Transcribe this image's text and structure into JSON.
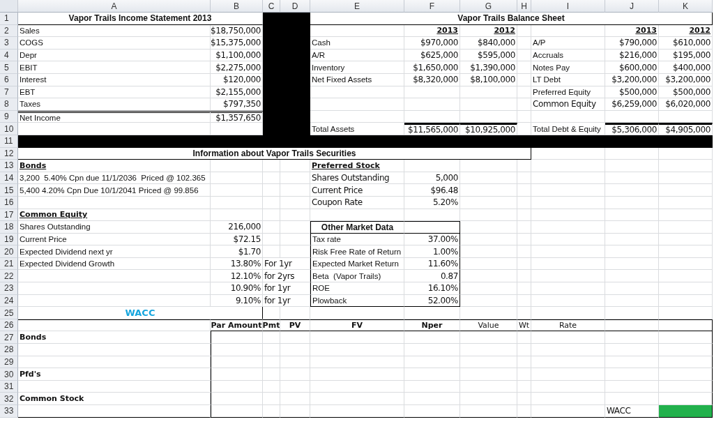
{
  "columns": [
    "A",
    "B",
    "C",
    "D",
    "E",
    "F",
    "G",
    "H",
    "I",
    "J",
    "K"
  ],
  "rows": [
    {
      "number": "1",
      "cells": {
        "A": {
          "kind": "title",
          "text": "Vapor Trails Income Statement 2013"
        },
        "E": {
          "kind": "title",
          "text": "Vapor Trails Balance Sheet"
        }
      }
    },
    {
      "number": "2",
      "cells": {
        "A": {
          "kind": "label",
          "text": "Sales"
        },
        "B": {
          "kind": "money",
          "text": "$18,750,000"
        },
        "F": {
          "kind": "year",
          "text": "2013"
        },
        "G": {
          "kind": "year",
          "text": "2012"
        },
        "J": {
          "kind": "year",
          "text": "2013"
        },
        "K": {
          "kind": "year",
          "text": "2012"
        }
      }
    },
    {
      "number": "3",
      "cells": {
        "A": {
          "kind": "label",
          "text": "COGS"
        },
        "B": {
          "kind": "money",
          "text": "$15,375,000"
        },
        "E": {
          "kind": "label",
          "text": "Cash"
        },
        "F": {
          "kind": "money",
          "text": "$970,000"
        },
        "G": {
          "kind": "money",
          "text": "$840,000"
        },
        "I": {
          "kind": "label",
          "text": "A/P"
        },
        "J": {
          "kind": "money",
          "text": "$790,000"
        },
        "K": {
          "kind": "money",
          "text": "$610,000"
        }
      }
    },
    {
      "number": "4",
      "cells": {
        "A": {
          "kind": "label",
          "text": "Depr"
        },
        "B": {
          "kind": "money",
          "text": "$1,100,000"
        },
        "E": {
          "kind": "label",
          "text": "A/R"
        },
        "F": {
          "kind": "money",
          "text": "$625,000"
        },
        "G": {
          "kind": "money",
          "text": "$595,000"
        },
        "I": {
          "kind": "label",
          "text": "Accruals"
        },
        "J": {
          "kind": "money",
          "text": "$216,000"
        },
        "K": {
          "kind": "money",
          "text": "$195,000"
        }
      }
    },
    {
      "number": "5",
      "cells": {
        "A": {
          "kind": "label",
          "text": "EBIT"
        },
        "B": {
          "kind": "money",
          "text": "$2,275,000"
        },
        "E": {
          "kind": "label",
          "text": "Inventory"
        },
        "F": {
          "kind": "money",
          "text": "$1,650,000"
        },
        "G": {
          "kind": "money",
          "text": "$1,390,000"
        },
        "I": {
          "kind": "label",
          "text": "Notes Pay"
        },
        "J": {
          "kind": "money",
          "text": "$600,000"
        },
        "K": {
          "kind": "money",
          "text": "$400,000"
        }
      }
    },
    {
      "number": "6",
      "cells": {
        "A": {
          "kind": "label",
          "text": "Interest"
        },
        "B": {
          "kind": "money",
          "text": "$120,000"
        },
        "E": {
          "kind": "label",
          "text": "Net Fixed Assets"
        },
        "F": {
          "kind": "money",
          "text": "$8,320,000"
        },
        "G": {
          "kind": "money",
          "text": "$8,100,000"
        },
        "I": {
          "kind": "label",
          "text": "LT Debt"
        },
        "J": {
          "kind": "money",
          "text": "$3,200,000"
        },
        "K": {
          "kind": "money",
          "text": "$3,200,000"
        }
      }
    },
    {
      "number": "7",
      "cells": {
        "A": {
          "kind": "label",
          "text": "EBT"
        },
        "B": {
          "kind": "money",
          "text": "$2,155,000"
        },
        "I": {
          "kind": "label",
          "text": "Preferred Equity"
        },
        "J": {
          "kind": "money",
          "text": "$500,000"
        },
        "K": {
          "kind": "money",
          "text": "$500,000"
        }
      }
    },
    {
      "number": "8",
      "cells": {
        "A": {
          "kind": "label",
          "text": "Taxes"
        },
        "B": {
          "kind": "money",
          "text": "$797,350"
        },
        "I": {
          "kind": "text",
          "text": "Common Equity"
        },
        "J": {
          "kind": "money",
          "text": "$6,259,000"
        },
        "K": {
          "kind": "money",
          "text": "$6,020,000"
        }
      }
    },
    {
      "number": "9",
      "cells": {
        "A": {
          "kind": "label",
          "text": "Net Income"
        },
        "B": {
          "kind": "money",
          "text": "$1,357,650"
        }
      }
    },
    {
      "number": "10",
      "cells": {
        "E": {
          "kind": "label",
          "text": "Total Assets"
        },
        "F": {
          "kind": "money",
          "text": "$11,565,000"
        },
        "G": {
          "kind": "money",
          "text": "$10,925,000"
        },
        "I": {
          "kind": "label",
          "text": "Total Debt & Equity"
        },
        "J": {
          "kind": "money",
          "text": "$5,306,000"
        },
        "K": {
          "kind": "money",
          "text": "$4,905,000"
        }
      }
    },
    {
      "number": "11",
      "cells": {}
    },
    {
      "number": "12",
      "cells": {
        "A": {
          "kind": "title",
          "text": "Information about Vapor Trails Securities"
        }
      }
    },
    {
      "number": "13",
      "cells": {
        "A": {
          "kind": "section",
          "text": "Bonds"
        },
        "E": {
          "kind": "section",
          "text": "Preferred Stock"
        }
      }
    },
    {
      "number": "14",
      "cells": {
        "A": {
          "kind": "label",
          "text": "3,200  5.40% Cpn due 11/1/2036  Priced @ 102.365"
        },
        "E": {
          "kind": "text",
          "text": "Shares Outstanding"
        },
        "F": {
          "kind": "money",
          "text": "5,000"
        }
      }
    },
    {
      "number": "15",
      "cells": {
        "A": {
          "kind": "label",
          "text": "5,400 4.20% Cpn Due 10/1/2041 Priced @ 99.856"
        },
        "E": {
          "kind": "text",
          "text": "Current Price"
        },
        "F": {
          "kind": "money",
          "text": "$96.48"
        }
      }
    },
    {
      "number": "16",
      "cells": {
        "E": {
          "kind": "text",
          "text": "Coupon Rate"
        },
        "F": {
          "kind": "money",
          "text": "5.20%"
        }
      }
    },
    {
      "number": "17",
      "cells": {
        "A": {
          "kind": "section",
          "text": "Common Equity"
        }
      }
    },
    {
      "number": "18",
      "cells": {
        "A": {
          "kind": "label",
          "text": "Shares Outstanding"
        },
        "B": {
          "kind": "money",
          "text": "216,000"
        },
        "E": {
          "kind": "title",
          "text": "Other Market Data"
        }
      }
    },
    {
      "number": "19",
      "cells": {
        "A": {
          "kind": "label",
          "text": "Current Price"
        },
        "B": {
          "kind": "money",
          "text": "$72.15"
        },
        "E": {
          "kind": "label",
          "text": "Tax rate"
        },
        "F": {
          "kind": "money",
          "text": "37.00%"
        }
      }
    },
    {
      "number": "20",
      "cells": {
        "A": {
          "kind": "label",
          "text": "Expected Dividend next yr"
        },
        "B": {
          "kind": "money",
          "text": "$1.70"
        },
        "E": {
          "kind": "label",
          "text": "Risk Free Rate of Return"
        },
        "F": {
          "kind": "money",
          "text": "1.00%"
        }
      }
    },
    {
      "number": "21",
      "cells": {
        "A": {
          "kind": "label",
          "text": "Expected Dividend Growth"
        },
        "B": {
          "kind": "money",
          "text": "13.80%"
        },
        "C": {
          "kind": "text",
          "text": "For 1yr"
        },
        "E": {
          "kind": "label",
          "text": "Expected Market Return"
        },
        "F": {
          "kind": "money",
          "text": "11.60%"
        }
      }
    },
    {
      "number": "22",
      "cells": {
        "B": {
          "kind": "money",
          "text": "12.10%"
        },
        "C": {
          "kind": "text",
          "text": "for 2yrs"
        },
        "E": {
          "kind": "label",
          "text": "Beta  (Vapor Trails)"
        },
        "F": {
          "kind": "money",
          "text": "0.87"
        }
      }
    },
    {
      "number": "23",
      "cells": {
        "B": {
          "kind": "money",
          "text": "10.90%"
        },
        "C": {
          "kind": "text",
          "text": "for 1yr"
        },
        "E": {
          "kind": "label",
          "text": "ROE"
        },
        "F": {
          "kind": "money",
          "text": "16.10%"
        }
      }
    },
    {
      "number": "24",
      "cells": {
        "B": {
          "kind": "money",
          "text": "9.10%"
        },
        "C": {
          "kind": "text",
          "text": "for 1yr"
        },
        "E": {
          "kind": "label",
          "text": "Plowback"
        },
        "F": {
          "kind": "money",
          "text": "52.00%"
        }
      }
    },
    {
      "number": "25",
      "cells": {
        "A": {
          "kind": "accent",
          "text": "WACC"
        }
      }
    },
    {
      "number": "26",
      "cells": {
        "B": {
          "kind": "head",
          "text": "Par Amount"
        },
        "C": {
          "kind": "head",
          "text": "Pmt"
        },
        "D": {
          "kind": "head",
          "text": "PV"
        },
        "E": {
          "kind": "head",
          "text": "FV"
        },
        "F": {
          "kind": "head",
          "text": "Nper"
        },
        "G": {
          "kind": "center",
          "text": "Value"
        },
        "H": {
          "kind": "center",
          "text": "Wt"
        },
        "I": {
          "kind": "center",
          "text": "Rate"
        }
      }
    },
    {
      "number": "27",
      "cells": {
        "A": {
          "kind": "bold",
          "text": "Bonds"
        }
      }
    },
    {
      "number": "28",
      "cells": {}
    },
    {
      "number": "29",
      "cells": {}
    },
    {
      "number": "30",
      "cells": {
        "A": {
          "kind": "bold",
          "text": "Pfd's"
        }
      }
    },
    {
      "number": "31",
      "cells": {}
    },
    {
      "number": "32",
      "cells": {
        "A": {
          "kind": "bold",
          "text": "Common Stock"
        }
      }
    },
    {
      "number": "33",
      "cells": {
        "J": {
          "kind": "text",
          "text": "WACC"
        },
        "K": {
          "color": "#22b14c"
        }
      }
    }
  ]
}
